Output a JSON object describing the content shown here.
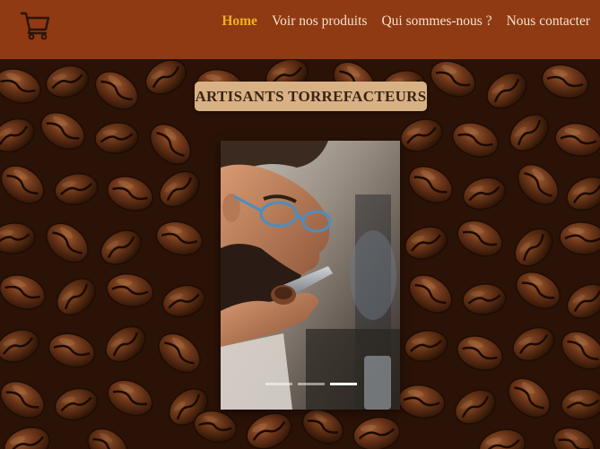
{
  "header": {
    "cart_icon": "shopping-cart-icon",
    "background_color": "#8f3a12",
    "nav": [
      {
        "label": "Home",
        "active": true
      },
      {
        "label": "Voir nos produits",
        "active": false
      },
      {
        "label": "Qui sommes-nous ?",
        "active": false
      },
      {
        "label": "Nous contacter",
        "active": false
      }
    ],
    "active_color": "#f0b020"
  },
  "hero": {
    "title": "ARTISANTS TORREFACTEURS",
    "badge_color": "#d8b285",
    "background": "coffee-beans-image",
    "carousel": {
      "image": "man-smelling-coffee-photo",
      "slides": 3,
      "active_slide": 3
    }
  }
}
